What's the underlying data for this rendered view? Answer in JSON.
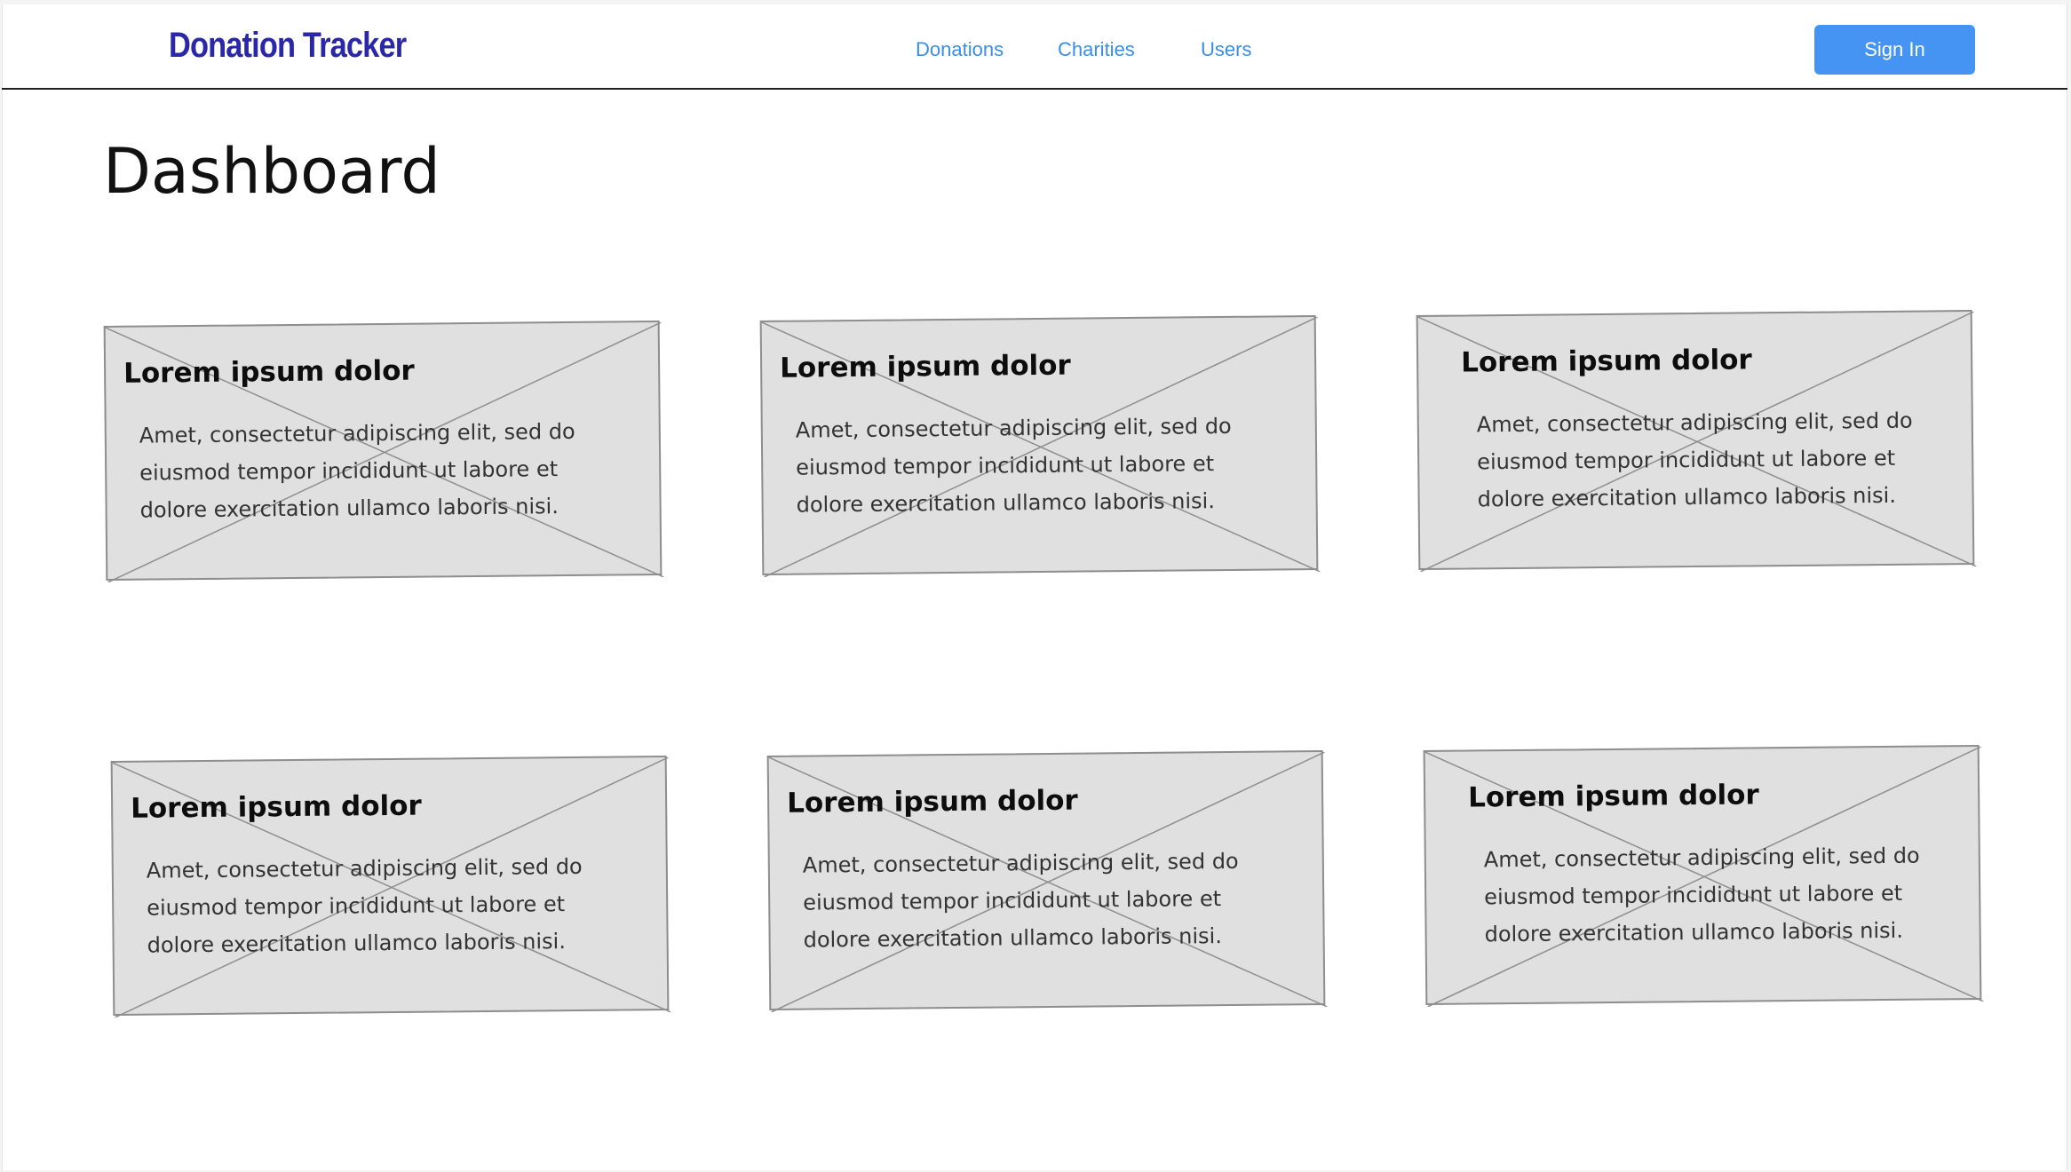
{
  "header": {
    "brand": "Donation Tracker",
    "nav": [
      "Donations",
      "Charities",
      "Users"
    ],
    "sign_in_label": "Sign In"
  },
  "page": {
    "title": "Dashboard"
  },
  "cards": [
    {
      "title": "Lorem ipsum dolor",
      "lines": [
        "Amet, consectetur adipiscing elit, sed do",
        "eiusmod tempor incididunt ut labore et",
        "dolore exercitation ullamco laboris nisi."
      ]
    },
    {
      "title": "Lorem ipsum dolor",
      "lines": [
        "Amet, consectetur adipiscing elit, sed do",
        "eiusmod tempor incididunt ut labore et",
        "dolore exercitation ullamco laboris nisi."
      ]
    },
    {
      "title": "Lorem ipsum dolor",
      "lines": [
        "Amet, consectetur adipiscing elit, sed do",
        "eiusmod tempor incididunt ut labore et",
        "dolore exercitation ullamco laboris nisi."
      ]
    },
    {
      "title": "Lorem ipsum dolor",
      "lines": [
        "Amet, consectetur adipiscing elit, sed do",
        "eiusmod tempor incididunt ut labore et",
        "dolore exercitation ullamco laboris nisi."
      ]
    },
    {
      "title": "Lorem ipsum dolor",
      "lines": [
        "Amet, consectetur adipiscing elit, sed do",
        "eiusmod tempor incididunt ut labore et",
        "dolore exercitation ullamco laboris nisi."
      ]
    },
    {
      "title": "Lorem ipsum dolor",
      "lines": [
        "Amet, consectetur adipiscing elit, sed do",
        "eiusmod tempor incididunt ut labore et",
        "dolore exercitation ullamco laboris nisi."
      ]
    }
  ],
  "colors": {
    "brand": "#2a27a8",
    "nav_link": "#3b8ee5",
    "primary_button": "#4593f2",
    "placeholder_fill": "#e0e0e0",
    "placeholder_stroke": "#8e8e8e"
  },
  "icons": {
    "card_placeholder": "image-placeholder-icon"
  }
}
